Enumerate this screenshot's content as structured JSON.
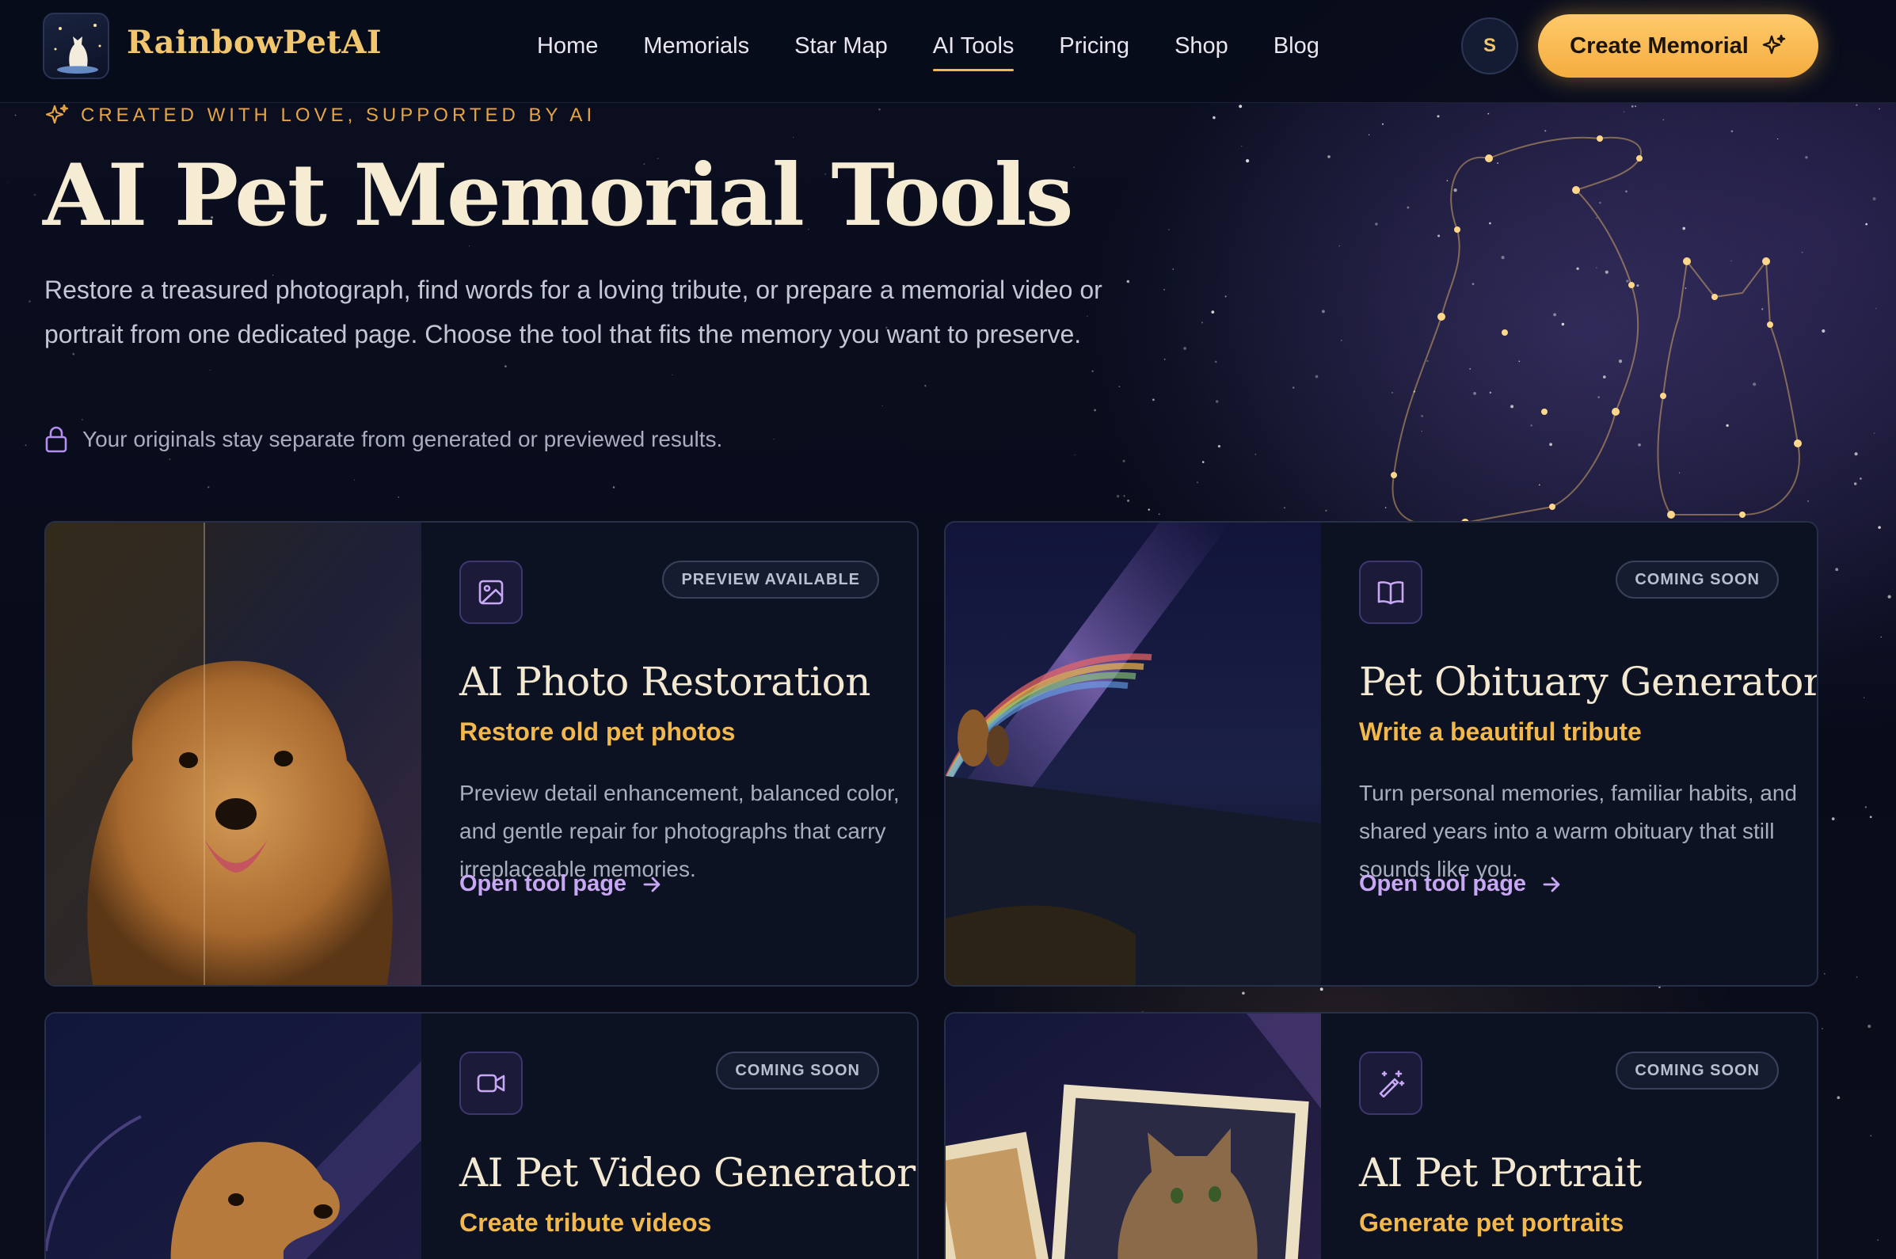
{
  "brand": {
    "name": "RainbowPetAI"
  },
  "nav": {
    "items": [
      {
        "label": "Home"
      },
      {
        "label": "Memorials"
      },
      {
        "label": "Star Map"
      },
      {
        "label": "AI Tools",
        "active": true
      },
      {
        "label": "Pricing"
      },
      {
        "label": "Shop"
      },
      {
        "label": "Blog"
      }
    ],
    "avatar_initial": "S",
    "cta_label": "Create Memorial"
  },
  "hero": {
    "eyebrow": "CREATED WITH LOVE, SUPPORTED BY AI",
    "title": "AI Pet Memorial Tools",
    "description": "Restore a treasured photograph, find words for a loving tribute, or prepare a memorial video or portrait from one dedicated page. Choose the tool that fits the memory you want to preserve.",
    "privacy_note": "Your originals stay separate from generated or previewed results."
  },
  "tools": [
    {
      "badge": "PREVIEW AVAILABLE",
      "title": "AI Photo Restoration",
      "subtitle": "Restore old pet photos",
      "description": "Preview detail enhancement, balanced color, and gentle repair for photographs that carry irreplaceable memories.",
      "link": "Open tool page",
      "icon": "image-icon"
    },
    {
      "badge": "COMING SOON",
      "title": "Pet Obituary Generator",
      "subtitle": "Write a beautiful tribute",
      "description": "Turn personal memories, familiar habits, and shared years into a warm obituary that still sounds like you.",
      "link": "Open tool page",
      "icon": "book-icon"
    },
    {
      "badge": "COMING SOON",
      "title": "AI Pet Video Generator",
      "subtitle": "Create tribute videos",
      "icon": "video-icon"
    },
    {
      "badge": "COMING SOON",
      "title": "AI Pet Portrait",
      "subtitle": "Generate pet portraits",
      "icon": "magic-wand-icon"
    }
  ],
  "colors": {
    "accent": "#f3b84c",
    "link": "#c8a8f4",
    "background": "#080c1a",
    "card": "#0d1222"
  }
}
